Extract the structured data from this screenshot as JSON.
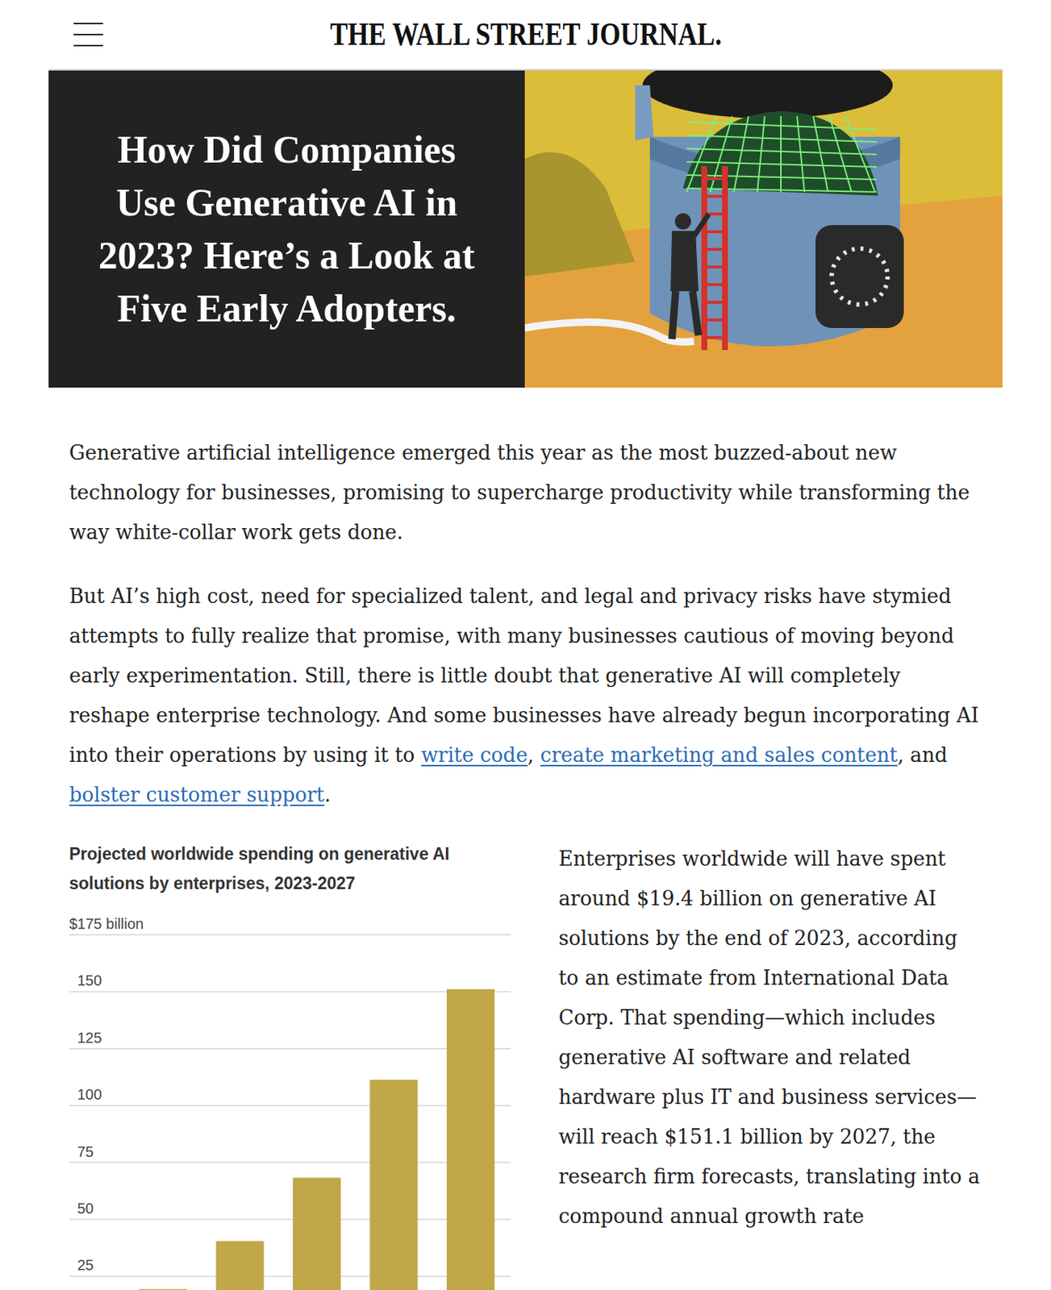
{
  "header": {
    "logo": "THE WALL STREET JOURNAL."
  },
  "headline": "How Did Companies Use Generative AI in 2023? Here’s a Look at Five Early Adopters.",
  "paragraphs": [
    [
      {
        "text": "Generative artificial intelligence emerged this year as the most buzzed-about new technology for businesses, promising to supercharge productivity while transforming the way white-collar work gets done.",
        "link": false
      }
    ],
    [
      {
        "text": "But AI’s high cost, need for specialized talent, and legal and privacy risks have stymied attempts to fully realize that promise, with many businesses cautious of moving beyond early experimentation. Still, there is little doubt that generative AI will completely reshape enterprise technology. And some businesses have already begun incorporating AI into their operations by using it to ",
        "link": false
      },
      {
        "text": "write code",
        "link": true
      },
      {
        "text": ", ",
        "link": false
      },
      {
        "text": "create marketing and sales content",
        "link": true
      },
      {
        "text": ", and ",
        "link": false
      },
      {
        "text": "bolster customer support",
        "link": true
      },
      {
        "text": ".",
        "link": false
      }
    ]
  ],
  "chart": {
    "title": "Projected worldwide spending on generative AI solutions by enterprises, 2023-2027",
    "unit_label": "$175 billion",
    "ticks": [
      "150",
      "125",
      "100",
      "75",
      "50",
      "25"
    ],
    "values": [
      19.4,
      40.5,
      68.3,
      111.3,
      151.1
    ]
  },
  "side_text": "Enterprises worldwide will have spent around $19.4 billion on generative AI solutions by the end of 2023, according to an estimate from International Data Corp. That spending—which includes generative AI software and related hardware plus IT and business services—will reach $151.1 billion by 2027, the research firm forecasts, translating into a compound annual growth rate"
}
